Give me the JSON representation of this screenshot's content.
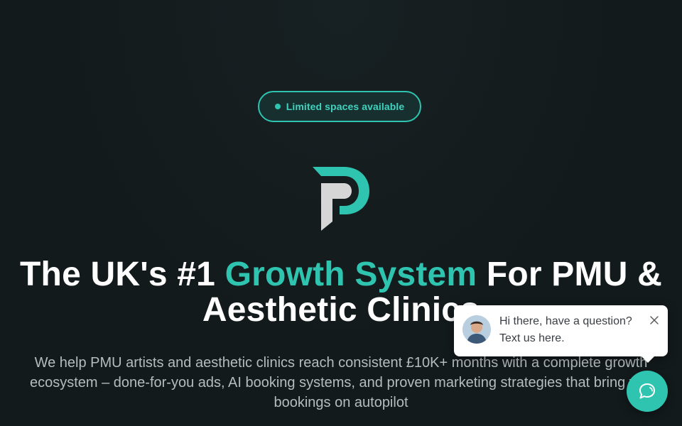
{
  "badge": {
    "label": "Limited spaces available",
    "dot_color": "#2ec4b0"
  },
  "logo": {
    "icon": "pmu-p-logo-icon",
    "colors": [
      "#2ec4b0",
      "#d8d8d8"
    ]
  },
  "hero": {
    "headline_pre": "The UK's #1 ",
    "headline_accent": "Growth System",
    "headline_post": " For PMU & Aesthetic Clinics",
    "subtext": "We help PMU artists and aesthetic clinics reach consistent £10K+ months with a complete growth ecosystem – done-for-you ads, AI booking systems, and proven marketing strategies that bring you bookings on autopilot"
  },
  "chat": {
    "line1": "Hi there, have a question?",
    "line2": "Text us here.",
    "avatar_icon": "agent-avatar",
    "close_icon": "close-icon",
    "launcher_icon": "chat-bubble-icon"
  },
  "colors": {
    "accent": "#2ec4b0",
    "background": "#131a1c",
    "text": "#ffffff"
  }
}
